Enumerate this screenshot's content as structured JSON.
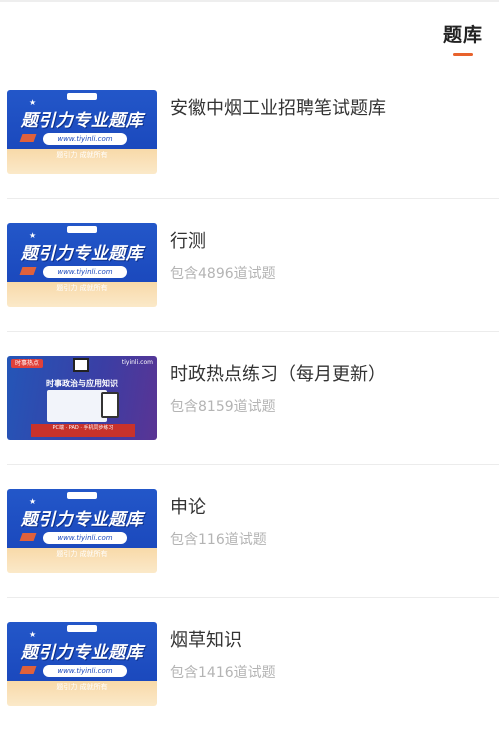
{
  "header": {
    "tab_label": "题库"
  },
  "items": [
    {
      "title": "安徽中烟工业招聘笔试题库",
      "count": "",
      "thumb": {
        "style": "blue-banner",
        "heading": "题引力专业题库",
        "url": "www.tiyinli.com",
        "slogan": "题引力 成就所有"
      }
    },
    {
      "title": "行测",
      "count": "包含4896道试题",
      "thumb": {
        "style": "blue-banner",
        "heading": "题引力专业题库",
        "url": "www.tiyinli.com",
        "slogan": "题引力 成就所有"
      }
    },
    {
      "title": "时政热点练习（每月更新）",
      "count": "包含8159道试题",
      "thumb": {
        "style": "current-affairs",
        "tag": "时事热点",
        "site": "tiyinli.com",
        "heading": "时事政治与应用知识",
        "footer": "PC端 · PAD · 手机同步练习"
      }
    },
    {
      "title": "申论",
      "count": "包含116道试题",
      "thumb": {
        "style": "blue-banner",
        "heading": "题引力专业题库",
        "url": "www.tiyinli.com",
        "slogan": "题引力 成就所有"
      }
    },
    {
      "title": "烟草知识",
      "count": "包含1416道试题",
      "thumb": {
        "style": "blue-banner",
        "heading": "题引力专业题库",
        "url": "www.tiyinli.com",
        "slogan": "题引力 成就所有"
      }
    }
  ],
  "colors": {
    "accent": "#e8622c",
    "banner_blue": "#1b49bd",
    "count_gray": "#b4b4b4"
  }
}
